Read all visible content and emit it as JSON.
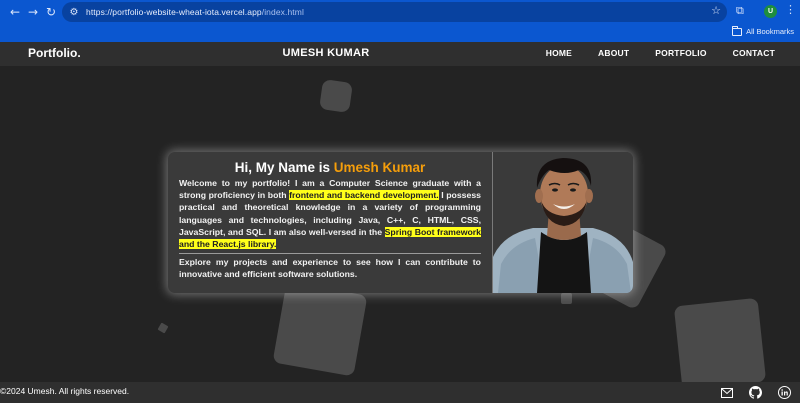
{
  "browser": {
    "url_host": "https://portfolio-website-wheat-iota.vercel.app",
    "url_path": "/index.html",
    "profile_initial": "U",
    "all_bookmarks_label": "All Bookmarks"
  },
  "nav": {
    "brand": "Portfolio.",
    "center_name": "UMESH KUMAR",
    "links": [
      "HOME",
      "ABOUT",
      "PORTFOLIO",
      "CONTACT"
    ]
  },
  "hero": {
    "greeting_prefix": "Hi, My Name is ",
    "greeting_name": "Umesh Kumar",
    "para1_a": "Welcome to my portfolio! I am a Computer Science graduate with a strong proficiency in both ",
    "para1_hl1": "frontend and backend development.",
    "para1_b": " I possess practical and theoretical knowledge in a variety of programming languages and technologies, including Java, C++, C, HTML, CSS, JavaScript, and SQL. I am also well-versed in the ",
    "para1_hl2": "Spring Boot framework and the React.js library.",
    "para2": "Explore my projects and experience to see how I can contribute to innovative and efficient software solutions."
  },
  "footer": {
    "copyright": "©2024 Umesh. All rights reserved.",
    "icons": [
      "mail-icon",
      "github-icon",
      "linkedin-icon"
    ]
  },
  "colors": {
    "accent": "#f59e0b",
    "highlight": "#ffff1a",
    "chrome": "#0b57d0"
  }
}
